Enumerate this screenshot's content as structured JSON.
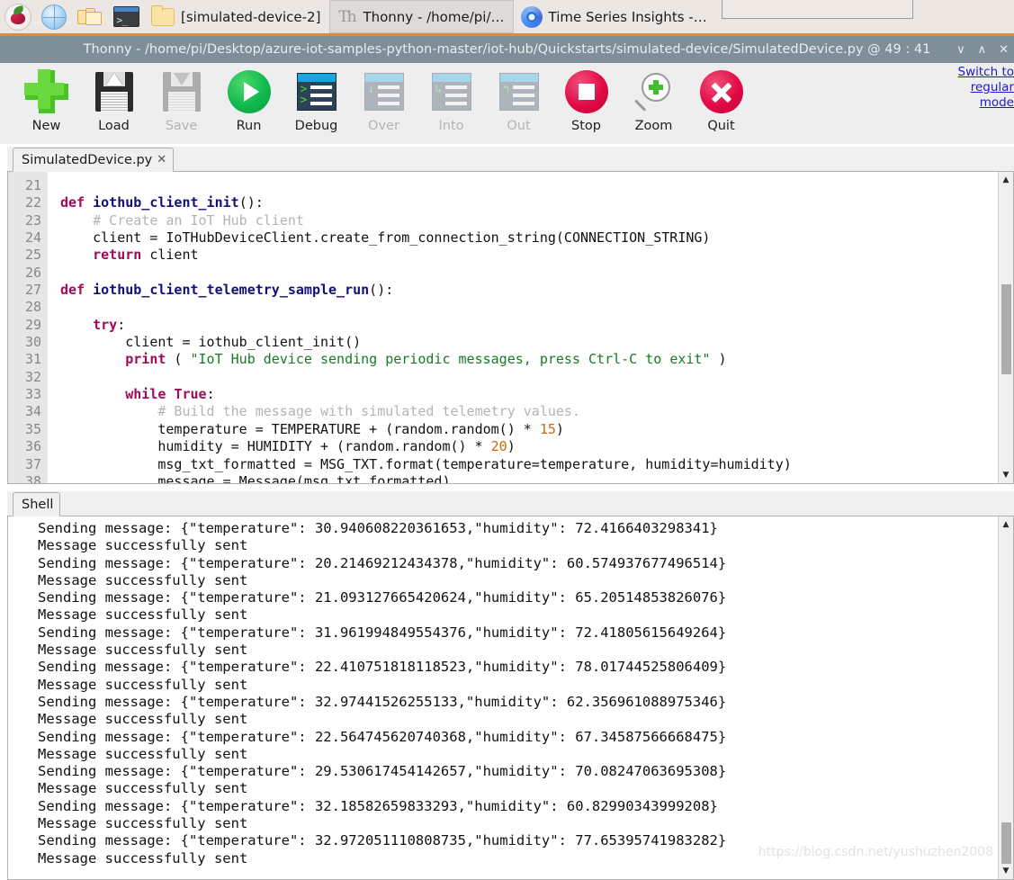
{
  "taskbar": {
    "launchers": [
      {
        "name": "raspberry-menu-icon",
        "label": ""
      },
      {
        "name": "web-browser-icon",
        "label": ""
      },
      {
        "name": "file-manager-icon",
        "label": ""
      },
      {
        "name": "terminal-icon",
        "label": ""
      }
    ],
    "tasks": [
      {
        "name": "taskbar-item-file-manager",
        "label": "[simulated-device-2]",
        "icon": "folder-icon",
        "active": false
      },
      {
        "name": "taskbar-item-thonny",
        "label": "Thonny  -  /home/pi/…",
        "icon": "thonny-icon",
        "active": true
      },
      {
        "name": "taskbar-item-browser",
        "label": "Time Series Insights -…",
        "icon": "chromium-icon",
        "active": false
      }
    ]
  },
  "window": {
    "title": "Thonny  -  /home/pi/Desktop/azure-iot-samples-python-master/iot-hub/Quickstarts/simulated-device/SimulatedDevice.py  @  49 : 41",
    "buttons": [
      {
        "name": "minimize-button",
        "glyph": "∨"
      },
      {
        "name": "maximize-button",
        "glyph": "∧"
      },
      {
        "name": "close-button",
        "glyph": "✕"
      }
    ]
  },
  "toolbar": {
    "items": [
      {
        "name": "new-button",
        "label": "New",
        "icon": "plus-icon",
        "disabled": false
      },
      {
        "name": "load-button",
        "label": "Load",
        "icon": "floppy-open-icon",
        "disabled": false
      },
      {
        "name": "save-button",
        "label": "Save",
        "icon": "floppy-save-icon",
        "disabled": true
      },
      {
        "name": "run-button",
        "label": "Run",
        "icon": "play-icon",
        "disabled": false
      },
      {
        "name": "debug-button",
        "label": "Debug",
        "icon": "debug-window-icon",
        "disabled": false
      },
      {
        "name": "step-over-button",
        "label": "Over",
        "icon": "step-over-icon",
        "disabled": true
      },
      {
        "name": "step-into-button",
        "label": "Into",
        "icon": "step-into-icon",
        "disabled": true
      },
      {
        "name": "step-out-button",
        "label": "Out",
        "icon": "step-out-icon",
        "disabled": true
      },
      {
        "name": "stop-button",
        "label": "Stop",
        "icon": "stop-icon",
        "disabled": false
      },
      {
        "name": "zoom-button",
        "label": "Zoom",
        "icon": "magnifier-plus-icon",
        "disabled": false
      },
      {
        "name": "quit-button",
        "label": "Quit",
        "icon": "close-circle-icon",
        "disabled": false
      }
    ],
    "switch_mode_link": {
      "line1": "Switch to",
      "line2": "regular",
      "line3": "mode"
    }
  },
  "editor": {
    "tab": {
      "label": "SimulatedDevice.py",
      "close_glyph": "✕"
    },
    "first_line_number": 21,
    "line_numbers": [
      "21",
      "22",
      "23",
      "24",
      "25",
      "26",
      "27",
      "28",
      "29",
      "30",
      "31",
      "32",
      "33",
      "34",
      "35",
      "36",
      "37",
      "38"
    ],
    "lines": [
      "",
      "def iothub_client_init():",
      "    # Create an IoT Hub client",
      "    client = IoTHubDeviceClient.create_from_connection_string(CONNECTION_STRING)",
      "    return client",
      "",
      "def iothub_client_telemetry_sample_run():",
      "",
      "    try:",
      "        client = iothub_client_init()",
      "        print ( \"IoT Hub device sending periodic messages, press Ctrl-C to exit\" )",
      "",
      "        while True:",
      "            # Build the message with simulated telemetry values.",
      "            temperature = TEMPERATURE + (random.random() * 15)",
      "            humidity = HUMIDITY + (random.random() * 20)",
      "            msg_txt_formatted = MSG_TXT.format(temperature=temperature, humidity=humidity)",
      "            message = Message(msg txt formatted)"
    ]
  },
  "shell": {
    "tab": {
      "label": "Shell"
    },
    "lines": [
      "Sending message: {\"temperature\": 30.940608220361653,\"humidity\": 72.4166403298341}",
      "Message successfully sent",
      "Sending message: {\"temperature\": 20.21469212434378,\"humidity\": 60.574937677496514}",
      "Message successfully sent",
      "Sending message: {\"temperature\": 21.093127665420624,\"humidity\": 65.20514853826076}",
      "Message successfully sent",
      "Sending message: {\"temperature\": 31.961994849554376,\"humidity\": 72.41805615649264}",
      "Message successfully sent",
      "Sending message: {\"temperature\": 22.410751818118523,\"humidity\": 78.01744525806409}",
      "Message successfully sent",
      "Sending message: {\"temperature\": 32.97441526255133,\"humidity\": 62.356961088975346}",
      "Message successfully sent",
      "Sending message: {\"temperature\": 22.564745620740368,\"humidity\": 67.34587566668475}",
      "Message successfully sent",
      "Sending message: {\"temperature\": 29.530617454142657,\"humidity\": 70.08247063695308}",
      "Message successfully sent",
      "Sending message: {\"temperature\": 32.18582659833293,\"humidity\": 60.82990343999208}",
      "Message successfully sent",
      "Sending message: {\"temperature\": 32.972051110808735,\"humidity\": 77.65395741983282}",
      "Message successfully sent"
    ]
  },
  "watermark": {
    "text": "https://blog.csdn.net/yushuzhen2008"
  },
  "colors": {
    "taskbar_bg": "#ede7e3",
    "taskbar_accent": "#e08a3c",
    "titlebar_bg": "#7e8f9a",
    "toolbar_bg": "#eeeeee",
    "gutter_bg": "#e6e6e6",
    "link": "#1a1ad0",
    "keyword": "#a00a5a",
    "function": "#10107a",
    "comment": "#b4b4b4",
    "string": "#177a25",
    "number": "#c66a10"
  }
}
